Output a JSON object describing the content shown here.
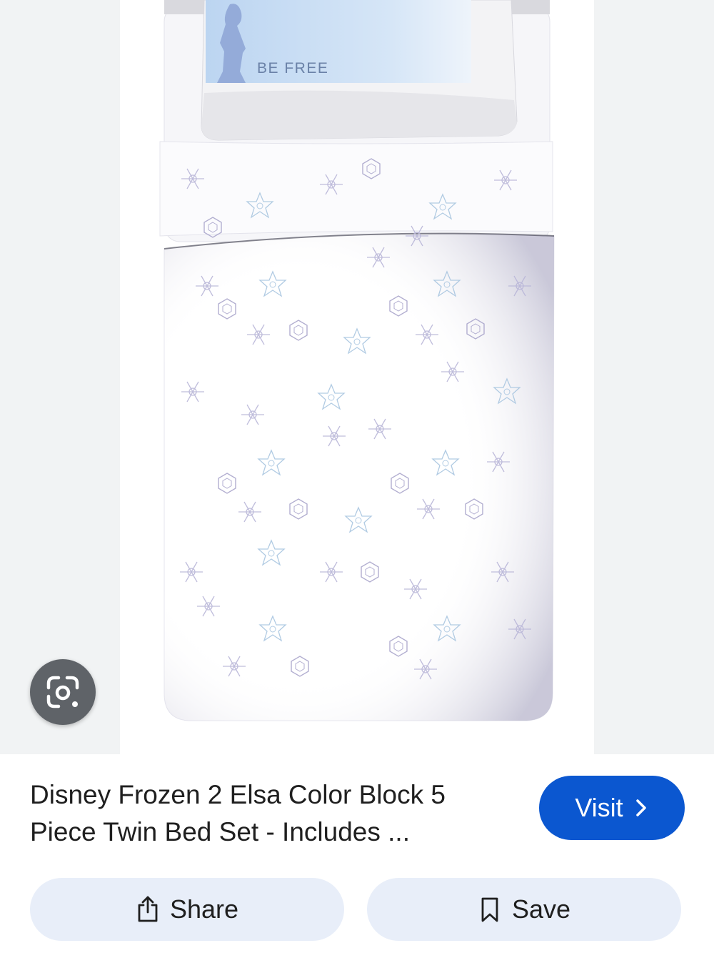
{
  "product_image": {
    "pillow_text": "BE FREE",
    "colors": {
      "pillow_band": "#c9def4",
      "sheet": "#ffffff",
      "snowflake": "#b9b6d8",
      "panel": "#f1f3f4"
    }
  },
  "lens": {
    "icon": "google-lens-icon"
  },
  "result": {
    "title_line1": "Disney Frozen 2 Elsa Color Block 5",
    "title_line2": "Piece Twin Bed Set - Includes ...",
    "visit_label": "Visit",
    "visit_icon": "chevron-right-icon"
  },
  "actions": {
    "share_label": "Share",
    "share_icon": "share-icon",
    "save_label": "Save",
    "save_icon": "bookmark-icon"
  },
  "colors": {
    "accent": "#0b57d0",
    "pill_bg": "#e8eef9"
  }
}
